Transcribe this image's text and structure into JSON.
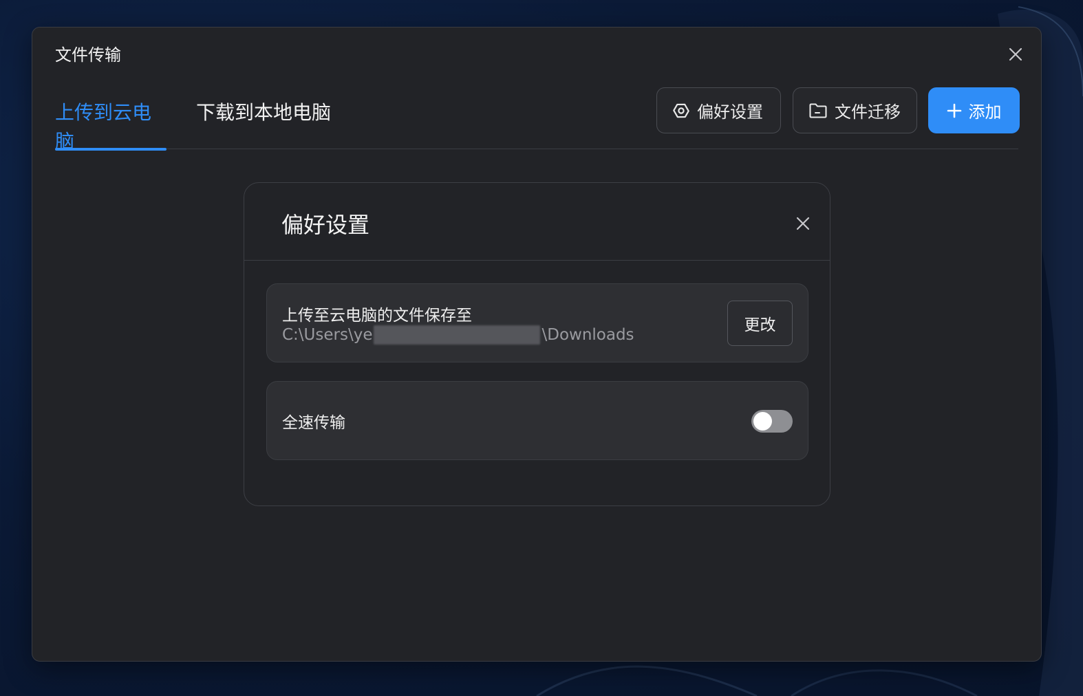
{
  "window": {
    "title": "文件传输",
    "close_icon": "close-icon"
  },
  "tabs": [
    {
      "label": "上传到云电脑",
      "active": true
    },
    {
      "label": "下载到本地电脑",
      "active": false
    }
  ],
  "toolbar": {
    "preferences_label": "偏好设置",
    "preferences_icon": "settings-hexagon-icon",
    "migrate_label": "文件迁移",
    "migrate_icon": "folder-icon",
    "add_label": "添加",
    "add_icon": "plus-icon"
  },
  "modal": {
    "title": "偏好设置",
    "save_location": {
      "label": "上传至云电脑的文件保存至",
      "path_prefix": "C:\\Users\\ye",
      "path_suffix": "\\Downloads",
      "change_label": "更改"
    },
    "full_speed": {
      "label": "全速传输",
      "enabled": false
    }
  },
  "colors": {
    "accent": "#2f8df7",
    "window_bg": "#222327",
    "card_bg": "#2e2f33"
  }
}
